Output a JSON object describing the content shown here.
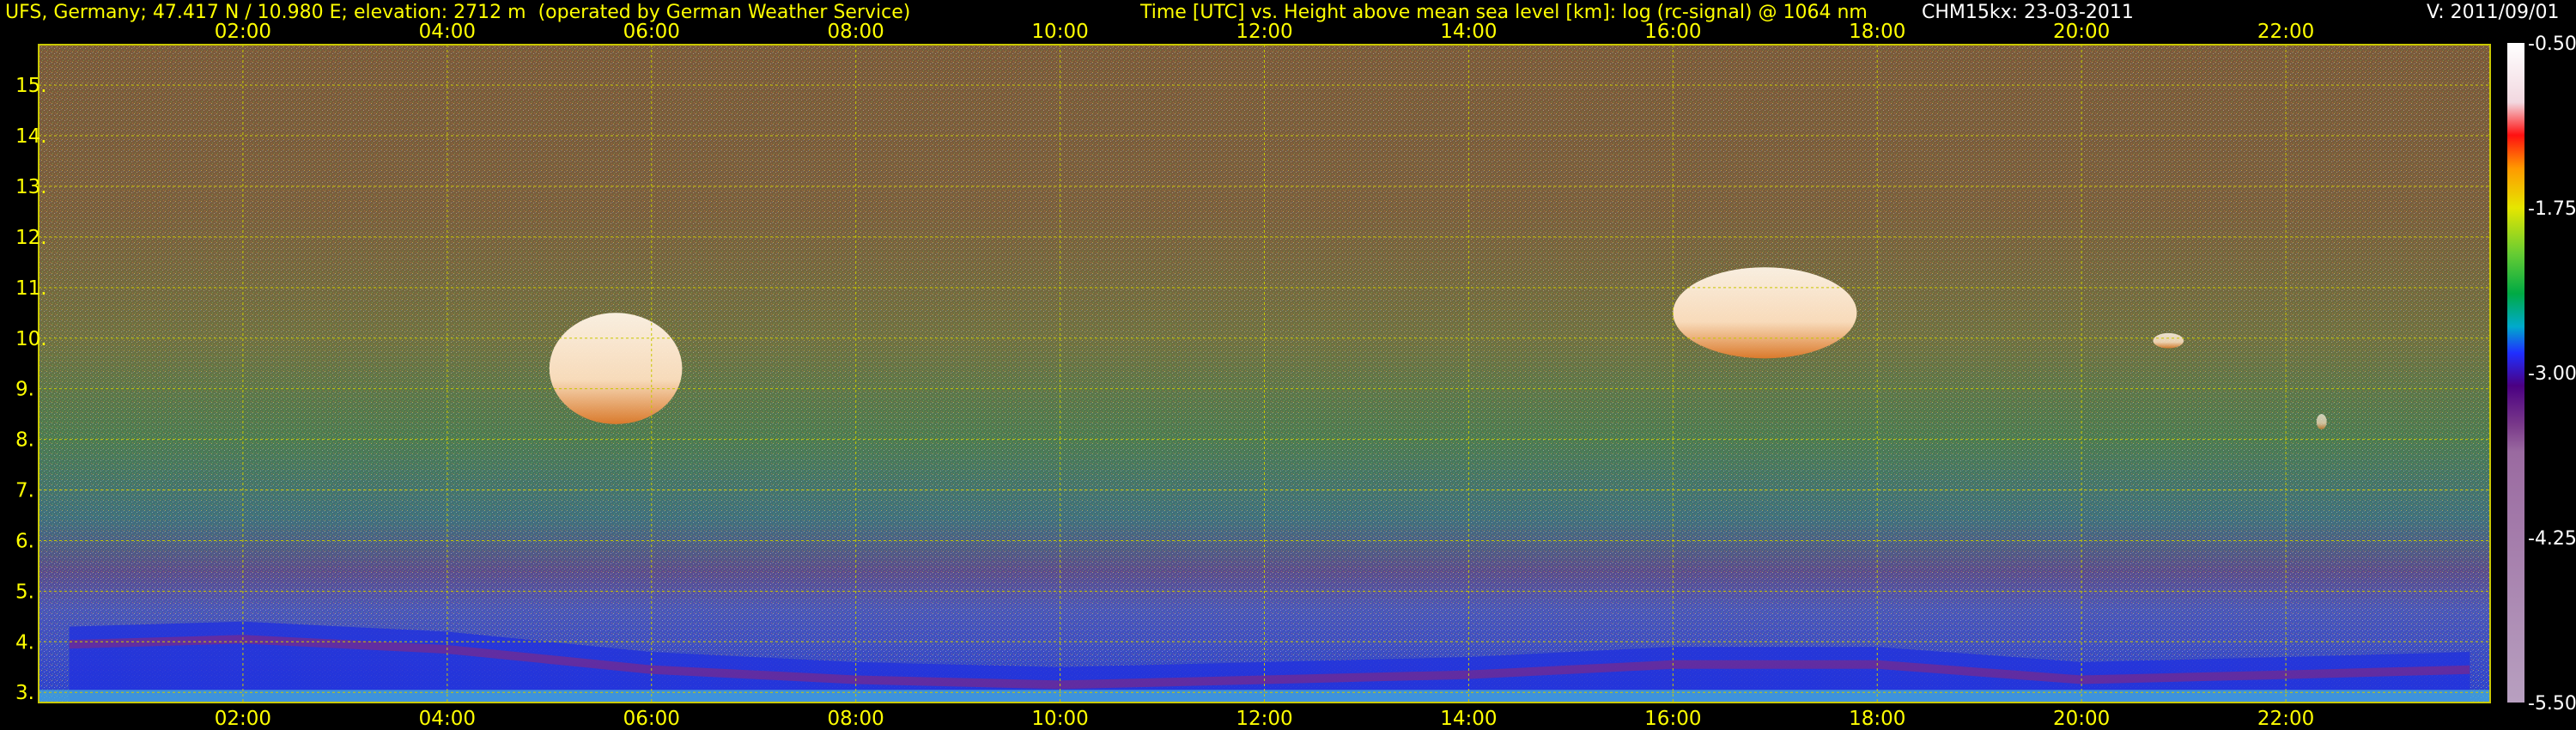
{
  "header": {
    "station": "UFS, Germany; 47.417 N / 10.980 E; elevation: 2712 m  (operated by German Weather Service)",
    "description": "Time [UTC] vs. Height above mean sea level [km]: log (rc-signal) @ 1064 nm",
    "instrument": "CHM15kx: 23-03-2011",
    "version": "V: 2011/09/01"
  },
  "colors": {
    "label": "#ffff00",
    "grid": "#c8c800",
    "frame": "#c8c800",
    "colorbar_text": "#ffffff"
  },
  "chart_data": {
    "type": "heatmap",
    "x_quantity": "time_utc_hours",
    "y_quantity": "height_km",
    "xlim": [
      0,
      24
    ],
    "ylim": [
      2.8,
      15.8
    ],
    "x_ticks": [
      2,
      4,
      6,
      8,
      10,
      12,
      14,
      16,
      18,
      20,
      22
    ],
    "x_tick_labels": [
      "02:00",
      "04:00",
      "06:00",
      "08:00",
      "10:00",
      "12:00",
      "14:00",
      "16:00",
      "18:00",
      "20:00",
      "22:00"
    ],
    "y_ticks": [
      3,
      4,
      5,
      6,
      7,
      8,
      9,
      10,
      11,
      12,
      13,
      14,
      15
    ],
    "y_tick_labels": [
      "3.",
      "4.",
      "5.",
      "6.",
      "7.",
      "8.",
      "9.",
      "10.",
      "11.",
      "12.",
      "13.",
      "14.",
      "15."
    ],
    "grid": true,
    "colorbar": {
      "min": -5.5,
      "max": -0.5,
      "ticks": [
        -0.5,
        -1.75,
        -3.0,
        -4.25,
        -5.5
      ],
      "tick_labels": [
        "-0.50",
        "-1.75",
        "-3.00",
        "-4.25",
        "-5.50"
      ]
    },
    "cloud_features": [
      {
        "t_start": 5.0,
        "t_end": 6.3,
        "h_bottom": 8.3,
        "h_top": 10.5,
        "intensity": "high"
      },
      {
        "t_start": 16.0,
        "t_end": 17.8,
        "h_bottom": 9.6,
        "h_top": 11.4,
        "intensity": "high"
      },
      {
        "t_start": 20.7,
        "t_end": 21.0,
        "h_bottom": 9.8,
        "h_top": 10.1,
        "intensity": "moderate"
      },
      {
        "t_start": 22.3,
        "t_end": 22.4,
        "h_bottom": 8.2,
        "h_top": 8.5,
        "intensity": "low"
      }
    ],
    "boundary_layer_top_km": [
      {
        "t": 0.3,
        "h": 4.3
      },
      {
        "t": 2.0,
        "h": 4.4
      },
      {
        "t": 4.0,
        "h": 4.2
      },
      {
        "t": 6.0,
        "h": 3.8
      },
      {
        "t": 8.0,
        "h": 3.6
      },
      {
        "t": 10.0,
        "h": 3.5
      },
      {
        "t": 12.0,
        "h": 3.6
      },
      {
        "t": 14.0,
        "h": 3.7
      },
      {
        "t": 16.0,
        "h": 3.9
      },
      {
        "t": 18.0,
        "h": 3.9
      },
      {
        "t": 20.0,
        "h": 3.6
      },
      {
        "t": 22.0,
        "h": 3.7
      },
      {
        "t": 23.8,
        "h": 3.8
      }
    ]
  }
}
